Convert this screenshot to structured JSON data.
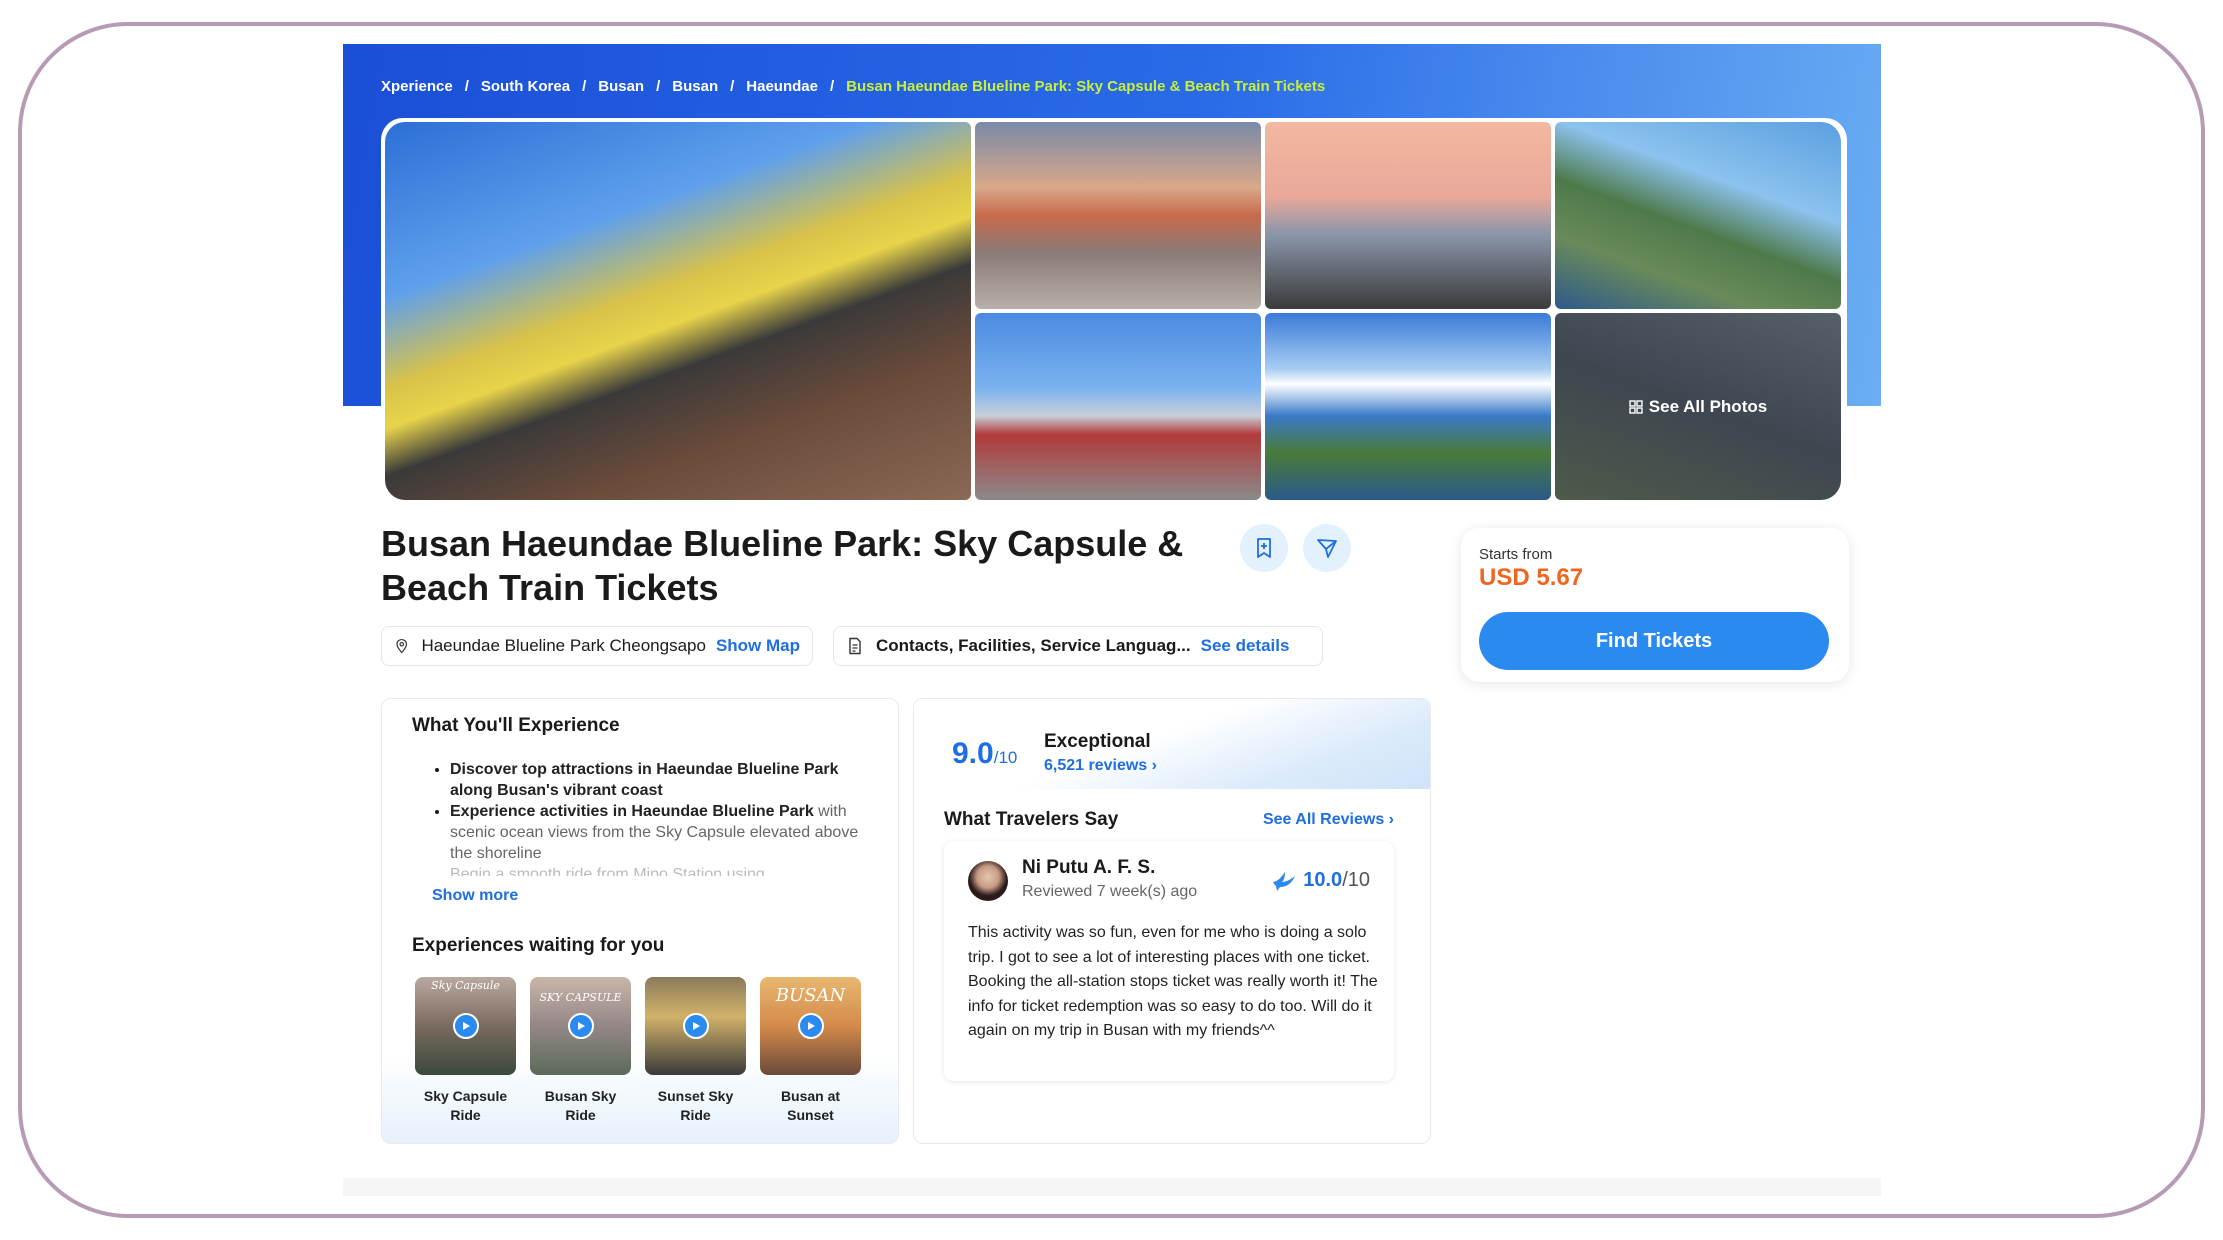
{
  "breadcrumb": {
    "items": [
      "Xperience",
      "South Korea",
      "Busan",
      "Busan",
      "Haeundae"
    ],
    "current": "Busan Haeundae Blueline Park: Sky Capsule & Beach Train Tickets",
    "separator": "/"
  },
  "gallery": {
    "see_all_label": "See All Photos"
  },
  "product": {
    "title": "Busan Haeundae Blueline Park: Sky Capsule & Beach Train Tickets",
    "location": "Haeundae Blueline Park Cheongsapo",
    "show_map": "Show Map",
    "details_summary": "Contacts, Facilities, Service Languag...",
    "see_details": "See details"
  },
  "pricing": {
    "starts_from_label": "Starts from",
    "price": "USD 5.67",
    "cta": "Find Tickets"
  },
  "experience": {
    "heading": "What You'll Experience",
    "bullets": [
      {
        "highlight": "Discover top attractions in Haeundae Blueline Park along Busan's vibrant coast",
        "rest": ""
      },
      {
        "highlight": "Experience activities in Haeundae Blueline Park",
        "rest": "with scenic ocean views from the Sky Capsule elevated above the shoreline"
      },
      {
        "highlight": "Begin a smooth ride from Mipo Station using",
        "rest": ""
      }
    ],
    "show_more": "Show more",
    "waiting_heading": "Experiences waiting for you",
    "videos": [
      {
        "name": "Sky Capsule Ride",
        "caption": "Sky Capsule"
      },
      {
        "name": "Busan Sky Ride",
        "caption": "SKY CAPSULE"
      },
      {
        "name": "Sunset Sky Ride",
        "caption": ""
      },
      {
        "name": "Busan at Sunset",
        "caption": "BUSAN"
      }
    ]
  },
  "reviews": {
    "score": "9.0",
    "score_max": "/10",
    "label": "Exceptional",
    "count": "6,521 reviews",
    "travelers_heading": "What Travelers Say",
    "see_all": "See All Reviews",
    "featured": {
      "name": "Ni Putu A. F. S.",
      "date": "Reviewed 7 week(s) ago",
      "score": "10.0",
      "score_max": "/10",
      "text": "This activity was so fun, even for me who is doing a solo trip. I got to see a lot of interesting places with one ticket. Booking the all-station stops ticket was really worth it! The info for ticket redemption was so easy to do too. Will do it again on my trip in Busan with my friends^^"
    }
  },
  "colors": {
    "brand_blue": "#1f6fe0",
    "cta_blue": "#2b8af0",
    "price_orange": "#f0661e",
    "breadcrumb_current": "#c7ef3a"
  }
}
